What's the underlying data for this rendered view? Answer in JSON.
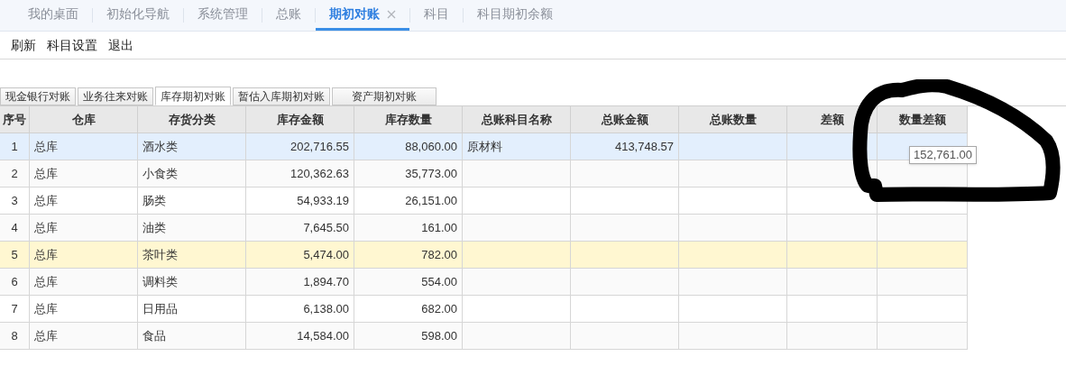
{
  "top_tabs": [
    {
      "label": "我的桌面",
      "selected": false,
      "closable": false
    },
    {
      "label": "初始化导航",
      "selected": false,
      "closable": false
    },
    {
      "label": "系统管理",
      "selected": false,
      "closable": false
    },
    {
      "label": "总账",
      "selected": false,
      "closable": false
    },
    {
      "label": "期初对账",
      "selected": true,
      "closable": true
    },
    {
      "label": "科目",
      "selected": false,
      "closable": false
    },
    {
      "label": "科目期初余额",
      "selected": false,
      "closable": false
    }
  ],
  "toolbar": [
    "刷新",
    "科目设置",
    "退出"
  ],
  "sub_tabs": [
    {
      "label": "现金银行对账",
      "selected": false
    },
    {
      "label": "业务往来对账",
      "selected": false
    },
    {
      "label": "库存期初对账",
      "selected": true
    },
    {
      "label": "暂估入库期初对账",
      "selected": false
    },
    {
      "label": "资产期初对账",
      "selected": false
    }
  ],
  "table": {
    "columns": [
      "序号",
      "仓库",
      "存货分类",
      "库存金额",
      "库存数量",
      "总账科目名称",
      "总账金额",
      "总账数量",
      "差额",
      "数量差额"
    ],
    "rows": [
      {
        "selected": true,
        "hovered": false,
        "cells": [
          "1",
          "总库",
          "酒水类",
          "202,716.55",
          "88,060.00",
          "原材料",
          "413,748.57",
          "",
          "",
          ""
        ]
      },
      {
        "selected": false,
        "hovered": false,
        "cells": [
          "2",
          "总库",
          "小食类",
          "120,362.63",
          "35,773.00",
          "",
          "",
          "",
          "",
          ""
        ]
      },
      {
        "selected": false,
        "hovered": false,
        "cells": [
          "3",
          "总库",
          "肠类",
          "54,933.19",
          "26,151.00",
          "",
          "",
          "",
          "",
          ""
        ]
      },
      {
        "selected": false,
        "hovered": false,
        "cells": [
          "4",
          "总库",
          "油类",
          "7,645.50",
          "161.00",
          "",
          "",
          "",
          "",
          ""
        ]
      },
      {
        "selected": false,
        "hovered": true,
        "cells": [
          "5",
          "总库",
          "茶叶类",
          "5,474.00",
          "782.00",
          "",
          "",
          "",
          "",
          ""
        ]
      },
      {
        "selected": false,
        "hovered": false,
        "cells": [
          "6",
          "总库",
          "调料类",
          "1,894.70",
          "554.00",
          "",
          "",
          "",
          "",
          ""
        ]
      },
      {
        "selected": false,
        "hovered": false,
        "cells": [
          "7",
          "总库",
          "日用品",
          "6,138.00",
          "682.00",
          "",
          "",
          "",
          "",
          ""
        ]
      },
      {
        "selected": false,
        "hovered": false,
        "cells": [
          "8",
          "总库",
          "食品",
          "14,584.00",
          "598.00",
          "",
          "",
          "",
          "",
          ""
        ]
      }
    ]
  },
  "tooltip": "152,761.00"
}
